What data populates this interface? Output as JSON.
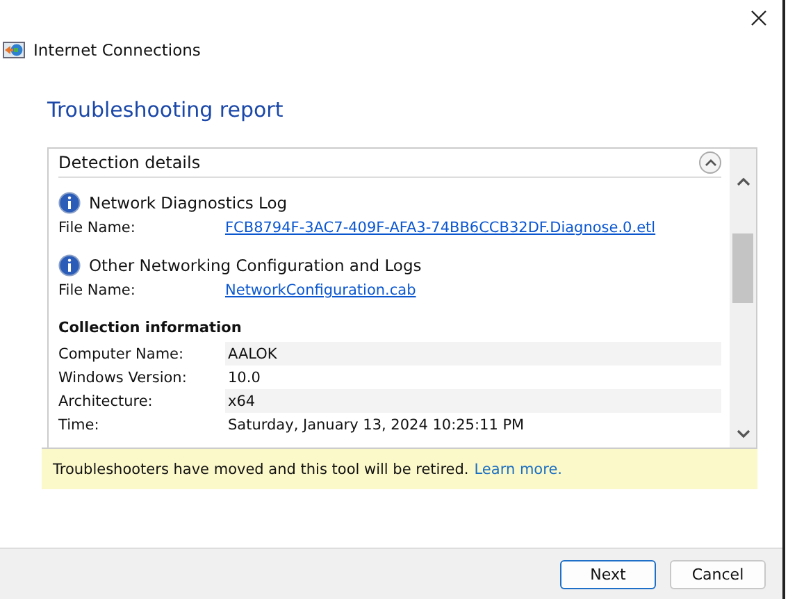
{
  "window": {
    "title": "Internet Connections"
  },
  "heading": "Troubleshooting report",
  "panel": {
    "title": "Detection details",
    "files": [
      {
        "name": "Network Diagnostics Log",
        "label": "File Name:",
        "link": "FCB8794F-3AC7-409F-AFA3-74BB6CCB32DF.Diagnose.0.etl"
      },
      {
        "name": "Other Networking Configuration and Logs",
        "label": "File Name:",
        "link": "NetworkConfiguration.cab"
      }
    ],
    "collection": {
      "title": "Collection information",
      "rows": [
        {
          "label": "Computer Name:",
          "value": "AALOK"
        },
        {
          "label": "Windows Version:",
          "value": "10.0"
        },
        {
          "label": "Architecture:",
          "value": "x64"
        },
        {
          "label": "Time:",
          "value": "Saturday, January 13, 2024 10:25:11 PM"
        }
      ]
    }
  },
  "notice": {
    "text": "Troubleshooters have moved and this tool will be retired.",
    "link": "Learn more."
  },
  "buttons": [
    {
      "label": "Next",
      "selected": true
    },
    {
      "label": "Cancel",
      "selected": false
    }
  ]
}
